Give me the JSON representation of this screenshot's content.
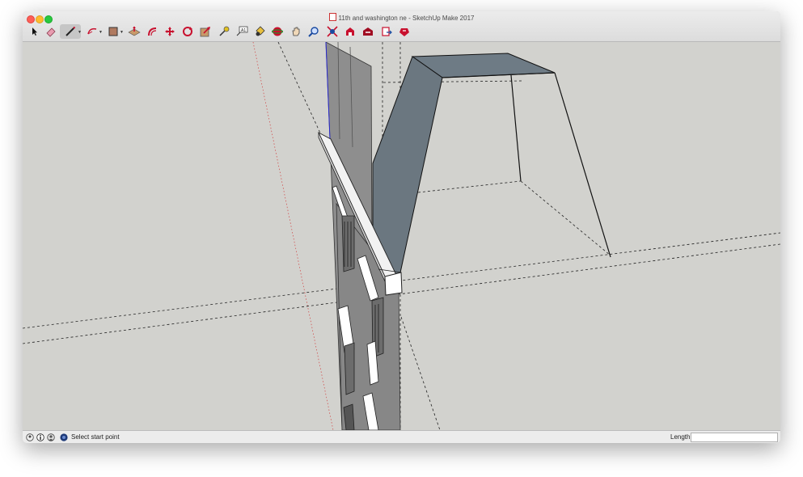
{
  "window": {
    "title": "11th and washington ne - SketchUp Make 2017"
  },
  "toolbar": {
    "tools": [
      {
        "name": "select-tool-icon",
        "label": "Select"
      },
      {
        "name": "eraser-tool-icon",
        "label": "Eraser"
      },
      {
        "name": "line-tool-icon",
        "label": "Line"
      },
      {
        "name": "arc-tool-icon",
        "label": "Arc"
      },
      {
        "name": "rectangle-tool-icon",
        "label": "Rectangle"
      },
      {
        "name": "push-pull-tool-icon",
        "label": "Push/Pull"
      },
      {
        "name": "offset-tool-icon",
        "label": "Offset"
      },
      {
        "name": "move-tool-icon",
        "label": "Move"
      },
      {
        "name": "rotate-tool-icon",
        "label": "Rotate"
      },
      {
        "name": "scale-tool-icon",
        "label": "Scale"
      },
      {
        "name": "tape-measure-tool-icon",
        "label": "Tape Measure"
      },
      {
        "name": "text-tool-icon",
        "label": "Text"
      },
      {
        "name": "paint-bucket-tool-icon",
        "label": "Paint Bucket"
      },
      {
        "name": "orbit-tool-icon",
        "label": "Orbit"
      },
      {
        "name": "pan-tool-icon",
        "label": "Pan"
      },
      {
        "name": "zoom-tool-icon",
        "label": "Zoom"
      },
      {
        "name": "zoom-extents-tool-icon",
        "label": "Zoom Extents"
      },
      {
        "name": "warehouse-tool-icon",
        "label": "3D Warehouse"
      },
      {
        "name": "extension-warehouse-tool-icon",
        "label": "Extension Warehouse"
      },
      {
        "name": "send-to-layout-tool-icon",
        "label": "Send to LayOut"
      },
      {
        "name": "extension-manager-tool-icon",
        "label": "Extension Manager"
      }
    ],
    "active_tool": "Line",
    "accent": "#c8102e"
  },
  "status": {
    "message": "Select start point",
    "length_label": "Length",
    "length_value": ""
  },
  "colors": {
    "viewport_bg": "#d2d2ce",
    "building_face": "#8b8b8b",
    "roof_face": "#6b7780",
    "red_axis": "#d04040",
    "blue_axis": "#2a2ad0"
  }
}
